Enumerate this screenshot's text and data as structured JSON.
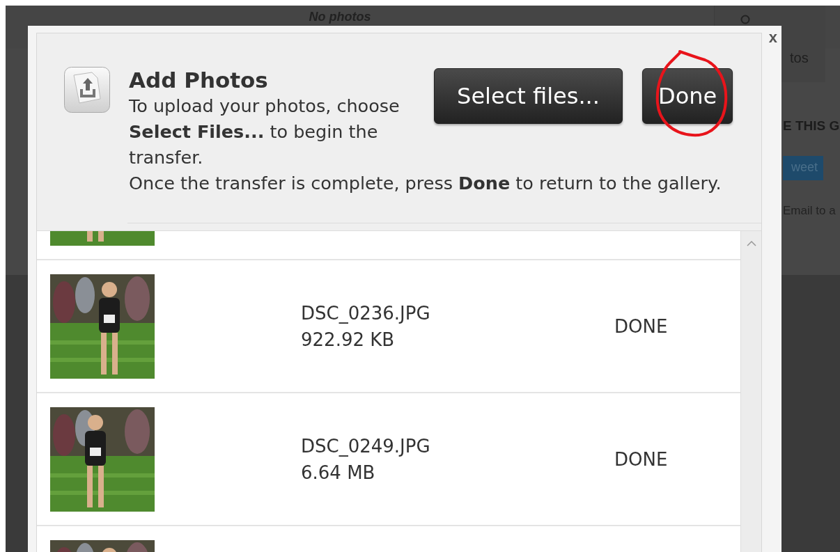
{
  "background_page": {
    "top_bar_text": "No photos",
    "corner_tab_text": "tos",
    "share_heading": "E THIS G",
    "tweet_button": "weet",
    "email_link": "Email to a"
  },
  "dialog": {
    "close": "x",
    "title": "Add Photos",
    "instructions": [
      "To upload your photos, choose **Select Files...** to begin the transfer.",
      "Once the transfer is complete, press **Done** to return to the gallery."
    ],
    "buttons": [
      "Select files...",
      "Done"
    ],
    "annotation": {
      "kind": "circle",
      "color": "#e8141b"
    }
  },
  "uploads": [
    {
      "thumbnail": {
        "kind": "picture"
      }
    },
    {
      "thumbnail": {
        "kind": "picture"
      },
      "file_name": "DSC_0236.JPG",
      "size": "922.92 KB",
      "status": "DONE"
    },
    {
      "thumbnail": {
        "kind": "picture"
      },
      "file_name": "DSC_0249.JPG",
      "size": "6.64 MB",
      "status": "DONE"
    },
    {
      "thumbnail": {
        "kind": "picture"
      }
    }
  ]
}
